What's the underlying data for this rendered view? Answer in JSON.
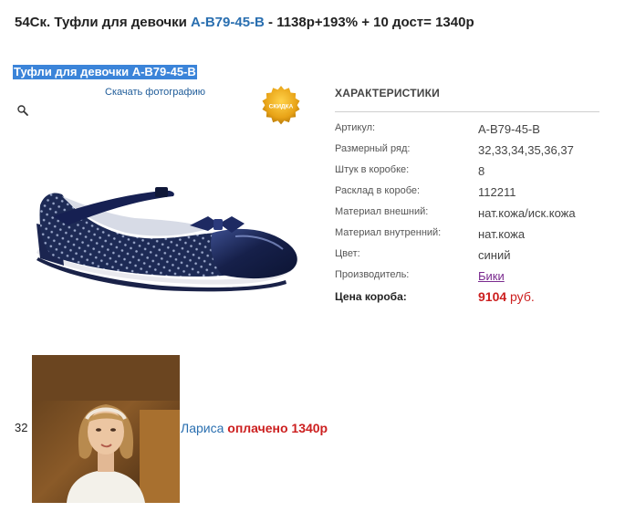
{
  "heading": {
    "prefix": "54Ск. Туфли для девочки ",
    "article_link": "А-В79-45-В",
    "suffix": " - 1138р+193% + 10 дост= 1340р"
  },
  "product": {
    "title": "Туфли для девочки А-В79-45-В",
    "download_label": "Скачать фотографию",
    "badge_text": "СКИДКА",
    "zoom_icon": "magnifier-icon"
  },
  "specs": {
    "title": "ХАРАКТЕРИСТИКИ",
    "rows": [
      {
        "label": "Артикул:",
        "value": "А-В79-45-В"
      },
      {
        "label": "Размерный ряд:",
        "value": "32,33,34,35,36,37"
      },
      {
        "label": "Штук в коробке:",
        "value": "8"
      },
      {
        "label": "Расклад в коробе:",
        "value": "112211"
      },
      {
        "label": "Материал внешний:",
        "value": "нат.кожа/иск.кожа"
      },
      {
        "label": "Материал внутренний:",
        "value": "нат.кожа"
      },
      {
        "label": "Цвет:",
        "value": "синий"
      },
      {
        "label": "Производитель:",
        "value": "Бики"
      }
    ],
    "price_label": "Цена короба:",
    "price_value": "9104",
    "price_currency": " руб."
  },
  "comment": {
    "number": "32",
    "name": "Лариса",
    "status": "оплачено 1340р"
  },
  "colors": {
    "link_blue": "#2a6fb0",
    "price_red": "#cc1f1f",
    "selection_blue": "#3b84d9",
    "badge_gold": "#e8a317",
    "manufacturer_purple": "#7a2a8e"
  }
}
